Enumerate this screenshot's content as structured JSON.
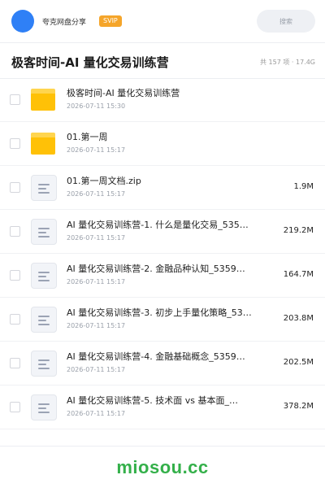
{
  "header": {
    "app_name": "夸克网盘分享",
    "badge": "SVIP",
    "search_placeholder": "搜索",
    "avatar_icon": "avatar-circle",
    "colors": {
      "avatar": "#2f80f6",
      "badge": "#f5a52a"
    }
  },
  "title_bar": {
    "title": "极客时间-AI 量化交易训练营",
    "meta": "共 157 项 · 17.4G"
  },
  "files": [
    {
      "type": "folder",
      "icon": "folder-icon",
      "name": "极客时间-AI 量化交易训练营",
      "date": "2026-07-11 15:30",
      "size": ""
    },
    {
      "type": "folder",
      "icon": "folder-icon",
      "name": "01.第一周",
      "date": "2026-07-11 15:17",
      "size": ""
    },
    {
      "type": "file",
      "icon": "file-icon",
      "name": "01.第一周文档.zip",
      "date": "2026-07-11 15:17",
      "size": "1.9M"
    },
    {
      "type": "file",
      "icon": "file-icon",
      "name": "AI 量化交易训练营-1. 什么是量化交易_535…",
      "date": "2026-07-11 15:17",
      "size": "219.2M"
    },
    {
      "type": "file",
      "icon": "file-icon",
      "name": "AI 量化交易训练营-2. 金融品种认知_5359…",
      "date": "2026-07-11 15:17",
      "size": "164.7M"
    },
    {
      "type": "file",
      "icon": "file-icon",
      "name": "AI 量化交易训练营-3. 初步上手量化策略_53…",
      "date": "2026-07-11 15:17",
      "size": "203.8M"
    },
    {
      "type": "file",
      "icon": "file-icon",
      "name": "AI 量化交易训练营-4. 金融基础概念_5359…",
      "date": "2026-07-11 15:17",
      "size": "202.5M"
    },
    {
      "type": "file",
      "icon": "file-icon",
      "name": "AI 量化交易训练营-5. 技术面 vs 基本面_…",
      "date": "2026-07-11 15:17",
      "size": "378.2M"
    }
  ],
  "watermark": {
    "text": "miosou.cc",
    "color": "#34b04a"
  }
}
